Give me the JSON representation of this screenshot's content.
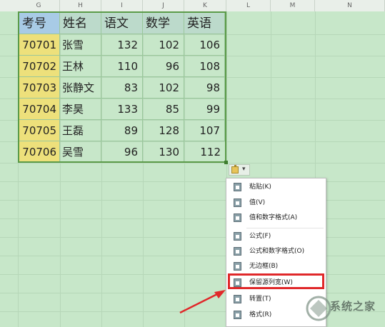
{
  "columns": [
    "G",
    "H",
    "I",
    "J",
    "K",
    "L",
    "M",
    "N"
  ],
  "table": {
    "headers": [
      "考号",
      "姓名",
      "语文",
      "数学",
      "英语"
    ],
    "rows": [
      [
        "70701",
        "张雪",
        "132",
        "102",
        "106"
      ],
      [
        "70702",
        "王林",
        "110",
        "96",
        "108"
      ],
      [
        "70703",
        "张静文",
        "83",
        "102",
        "98"
      ],
      [
        "70704",
        "李昊",
        "133",
        "85",
        "99"
      ],
      [
        "70705",
        "王磊",
        "89",
        "128",
        "107"
      ],
      [
        "70706",
        "吴雪",
        "96",
        "130",
        "112"
      ]
    ]
  },
  "paste_menu": {
    "items": [
      "粘贴(K)",
      "值(V)",
      "值和数字格式(A)",
      "公式(F)",
      "公式和数字格式(O)",
      "无边框(B)",
      "保留源列宽(W)",
      "转置(T)",
      "格式(R)"
    ]
  },
  "watermark": {
    "text": "系统之家"
  },
  "colors": {
    "highlight": "#e0282a",
    "table_border": "#5b9b49",
    "id_fill": "#ede07b",
    "header_fill": "#bcdacb"
  }
}
